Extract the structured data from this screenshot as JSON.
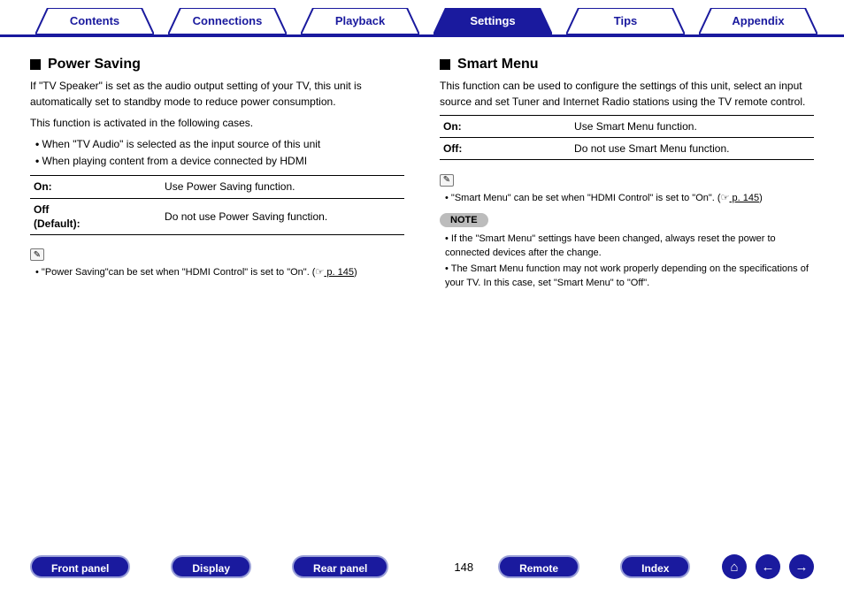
{
  "tabs": [
    "Contents",
    "Connections",
    "Playback",
    "Settings",
    "Tips",
    "Appendix"
  ],
  "activeTabIndex": 3,
  "left": {
    "title": "Power Saving",
    "desc1": "If \"TV Speaker\" is set as the audio output setting of your TV, this unit is automatically set to standby mode to reduce power consumption.",
    "desc2": "This function is activated in the following cases.",
    "bullets": [
      "When \"TV Audio\" is selected as the input source of this unit",
      "When playing content from a device connected by HDMI"
    ],
    "table": [
      {
        "k": "On:",
        "v": "Use Power Saving function."
      },
      {
        "k": "Off\n(Default):",
        "v": "Do not use Power Saving function."
      }
    ],
    "note1_pre": "\"Power Saving\"can be set when \"HDMI Control\" is set to \"On\".  (",
    "note1_link": " p. 145",
    "note1_post": ")"
  },
  "right": {
    "title": "Smart Menu",
    "desc": "This function can be used to configure the settings of this unit, select an input source and set Tuner and Internet Radio stations using the TV remote control.",
    "table": [
      {
        "k": "On:",
        "v": "Use Smart Menu function."
      },
      {
        "k": "Off:",
        "v": "Do not use Smart Menu function."
      }
    ],
    "note1_pre": "\"Smart Menu\" can be set when \"HDMI Control\" is set to \"On\".  (",
    "note1_link": " p. 145",
    "note1_post": ")",
    "noteBadge": "NOTE",
    "noteBullets": [
      "If the \"Smart Menu\" settings have been changed, always reset the power to connected devices after the change.",
      "The Smart Menu function may not work properly depending on the specifications of your TV. In this case, set \"Smart Menu\" to \"Off\"."
    ]
  },
  "bottom": {
    "pills": [
      "Front panel",
      "Display",
      "Rear panel",
      "Remote",
      "Index"
    ],
    "page": "148"
  },
  "icons": {
    "pencil": "✎",
    "pointer": "☞",
    "home": "⌂",
    "back": "←",
    "fwd": "→"
  }
}
